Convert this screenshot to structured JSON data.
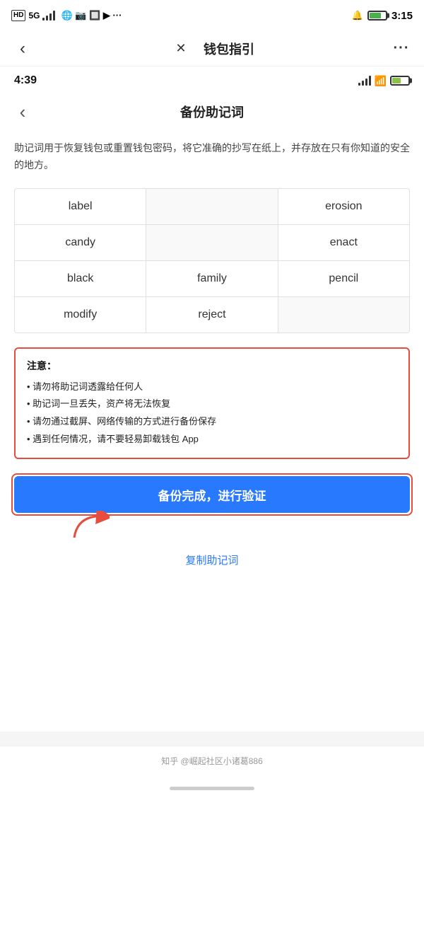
{
  "outer": {
    "status": {
      "left_icons": "HD 5G",
      "time": "3:15"
    },
    "nav": {
      "back_label": "‹",
      "close_label": "✕",
      "title": "钱包指引",
      "more_label": "···"
    }
  },
  "inner": {
    "status": {
      "time": "4:39"
    },
    "nav": {
      "back_label": "‹",
      "title": "备份助记词"
    },
    "desc": "助记词用于恢复钱包或重置钱包密码，将它准确的抄写在纸上，并存放在只有你知道的安全的地方。",
    "mnemonic": {
      "rows": [
        [
          "label",
          "",
          "erosion"
        ],
        [
          "candy",
          "",
          "enact"
        ],
        [
          "black",
          "family",
          "pencil"
        ],
        [
          "modify",
          "reject",
          ""
        ]
      ]
    },
    "warning": {
      "title": "注意：",
      "items": [
        "• 请勿将助记词透露给任何人",
        "• 助记词一旦丢失，资产将无法恢复",
        "• 请勿通过截屏、网络传输的方式进行备份保存",
        "• 遇到任何情况，请不要轻易卸载钱包 App"
      ]
    },
    "confirm_button": "备份完成，进行验证",
    "copy_link": "复制助记词"
  },
  "footer": {
    "text": "知乎 @崛起社区小诸葛886"
  }
}
